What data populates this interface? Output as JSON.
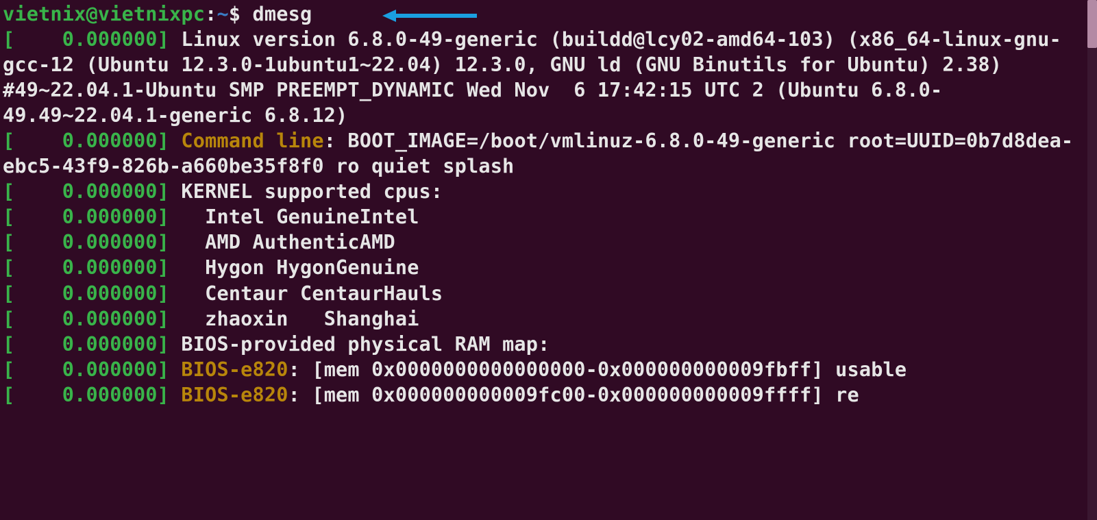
{
  "prompt": {
    "user": "vietnix",
    "at": "@",
    "host": "vietnixpc",
    "colon": ":",
    "path": "~",
    "dollar": "$ "
  },
  "command": "dmesg",
  "lines": [
    {
      "type": "ts",
      "ts": "    0.000000",
      "segments": [
        {
          "cls": "output-text",
          "text": " Linux version 6.8.0-49-generic (buildd@lcy02-amd64-103) (x86_64-linux-gnu-gcc-12 (Ubuntu 12.3.0-1ubuntu1~22.04) 12.3.0, GNU ld (GNU Binutils for Ubuntu) 2.38) #49~22.04.1-Ubuntu SMP PREEMPT_DYNAMIC Wed Nov  6 17:42:15 UTC 2 (Ubuntu 6.8.0-49.49~22.04.1-generic 6.8.12)"
        }
      ]
    },
    {
      "type": "ts",
      "ts": "    0.000000",
      "segments": [
        {
          "cls": "label",
          "text": " Command line"
        },
        {
          "cls": "output-text",
          "text": ": BOOT_IMAGE=/boot/vmlinuz-6.8.0-49-generic root=UUID=0b7d8dea-ebc5-43f9-826b-a660be35f8f0 ro quiet splash"
        }
      ]
    },
    {
      "type": "ts",
      "ts": "    0.000000",
      "segments": [
        {
          "cls": "output-text",
          "text": " KERNEL supported cpus:"
        }
      ]
    },
    {
      "type": "ts",
      "ts": "    0.000000",
      "segments": [
        {
          "cls": "output-text",
          "text": "   Intel GenuineIntel"
        }
      ]
    },
    {
      "type": "ts",
      "ts": "    0.000000",
      "segments": [
        {
          "cls": "output-text",
          "text": "   AMD AuthenticAMD"
        }
      ]
    },
    {
      "type": "ts",
      "ts": "    0.000000",
      "segments": [
        {
          "cls": "output-text",
          "text": "   Hygon HygonGenuine"
        }
      ]
    },
    {
      "type": "ts",
      "ts": "    0.000000",
      "segments": [
        {
          "cls": "output-text",
          "text": "   Centaur CentaurHauls"
        }
      ]
    },
    {
      "type": "ts",
      "ts": "    0.000000",
      "segments": [
        {
          "cls": "output-text",
          "text": "   zhaoxin   Shanghai"
        }
      ]
    },
    {
      "type": "ts",
      "ts": "    0.000000",
      "segments": [
        {
          "cls": "output-text",
          "text": " BIOS-provided physical RAM map:"
        }
      ]
    },
    {
      "type": "ts",
      "ts": "    0.000000",
      "segments": [
        {
          "cls": "label",
          "text": " BIOS-e820"
        },
        {
          "cls": "output-text",
          "text": ": [mem 0x0000000000000000-0x000000000009fbff] usable"
        }
      ]
    },
    {
      "type": "ts",
      "ts": "    0.000000",
      "segments": [
        {
          "cls": "label",
          "text": " BIOS-e820"
        },
        {
          "cls": "output-text",
          "text": ": [mem 0x000000000009fc00-0x000000000009ffff] re"
        }
      ]
    }
  ],
  "arrow_color": "#1a9fe0"
}
